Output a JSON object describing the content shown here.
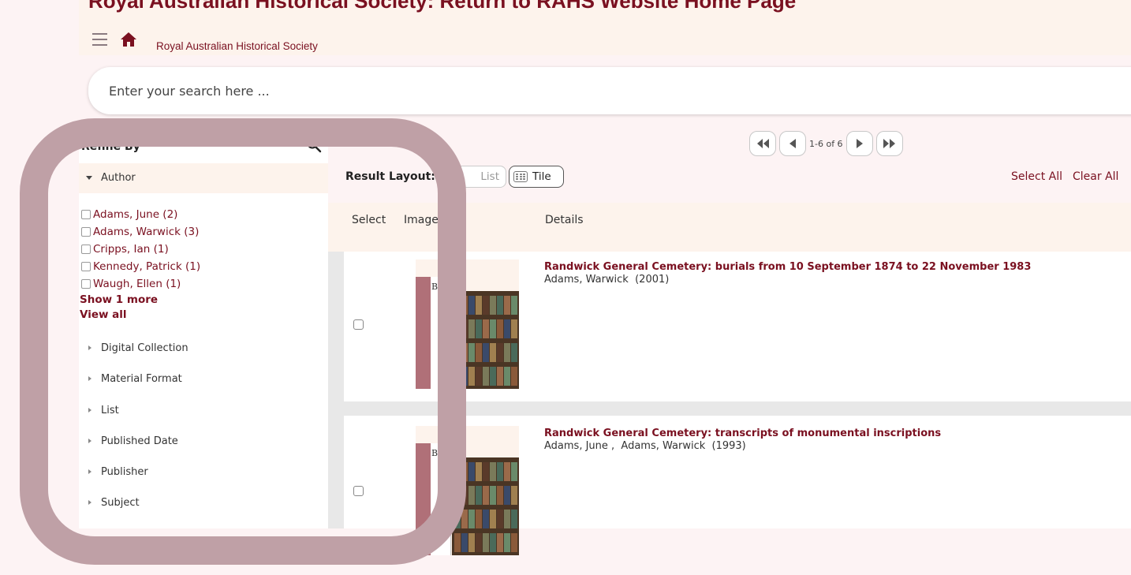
{
  "header": {
    "title_cut": "Royal Australian Historical Society: Return to RAHS Website Home Page",
    "site_name": "Royal Australian Historical Society"
  },
  "search": {
    "placeholder": "Enter your search here ..."
  },
  "sidebar": {
    "title": "Refine By",
    "author_facet": "Author",
    "authors": [
      "Adams, June (2)",
      "Adams, Warwick (3)",
      "Cripps, Ian (1)",
      "Kennedy, Patrick (1)",
      "Waugh, Ellen (1)"
    ],
    "show_more": "Show 1 more",
    "view_all": "View all",
    "facets": [
      "Digital Collection",
      "Material Format",
      "List",
      "Published Date",
      "Publisher",
      "Subject"
    ]
  },
  "pager": {
    "range": "1-6 of 6"
  },
  "toolbar": {
    "layout_label": "Result Layout:",
    "list_label": "List",
    "tile_label": "Tile",
    "select_all": "Select All",
    "clear_all": "Clear All"
  },
  "columns": {
    "select": "Select",
    "image": "Image",
    "details": "Details"
  },
  "results": [
    {
      "title": "Randwick General Cemetery: burials from 10 September 1874 to 22 November 1983",
      "authors": "Adams, Warwick  (2001)",
      "cover_text": "BOOK"
    },
    {
      "title": "Randwick General Cemetery: transcripts of monumental inscriptions",
      "authors": "Adams, June ,  Adams, Warwick  (1993)",
      "cover_text": "BOOK"
    }
  ],
  "colors": {
    "brand": "#7a1020",
    "highlight": "#bfa0a6",
    "header_bg": "#fdf3ec"
  }
}
